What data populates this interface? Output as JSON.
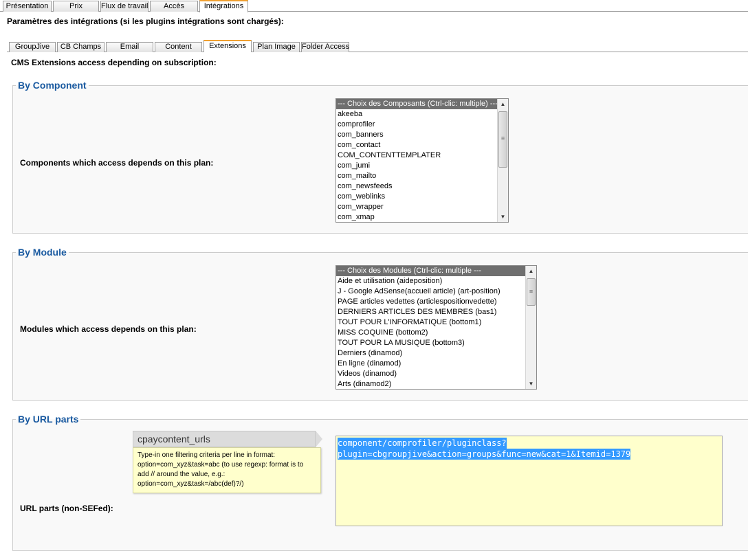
{
  "top_tabs": [
    {
      "label": "Présentation"
    },
    {
      "label": "Prix"
    },
    {
      "label": "Flux de travail"
    },
    {
      "label": "Accès"
    },
    {
      "label": "Intégrations",
      "active": true
    }
  ],
  "page_title": "Paramètres des intégrations (si les plugins intégrations sont chargés):",
  "sub_tabs": [
    {
      "label": "GroupJive"
    },
    {
      "label": "CB Champs"
    },
    {
      "label": "Email"
    },
    {
      "label": "Content"
    },
    {
      "label": "Extensions",
      "active": true
    },
    {
      "label": "Plan Image"
    },
    {
      "label": "Folder Access"
    }
  ],
  "sub_title": "CMS Extensions access depending on subscription:",
  "component_section": {
    "legend": "By Component",
    "label": "Components which access depends on this plan:",
    "options": [
      "--- Choix des Composants (Ctrl-clic: multiple) ---",
      "akeeba",
      "comprofiler",
      "com_banners",
      "com_contact",
      "COM_CONTENTTEMPLATER",
      "com_jumi",
      "com_mailto",
      "com_newsfeeds",
      "com_weblinks",
      "com_wrapper",
      "com_xmap"
    ]
  },
  "module_section": {
    "legend": "By Module",
    "label": "Modules which access depends on this plan:",
    "options": [
      "--- Choix des Modules (Ctrl-clic: multiple ---",
      "Aide et utilisation (aideposition)",
      "J - Google AdSense(accueil article) (art-position)",
      "PAGE articles vedettes (articlespositionvedette)",
      "DERNIERS ARTICLES DES MEMBRES (bas1)",
      "TOUT POUR L'INFORMATIQUE (bottom1)",
      "MISS COQUINE (bottom2)",
      "TOUT POUR LA MUSIQUE (bottom3)",
      "Derniers (dinamod)",
      "En ligne (dinamod)",
      "Videos (dinamod)",
      "Arts (dinamod2)"
    ]
  },
  "url_section": {
    "legend": "By URL parts",
    "label": "URL parts (non-SEFed):",
    "tooltip_title": "cpaycontent_urls",
    "tooltip_lines": [
      "Type-in one filtering criteria per line in format:",
      "option=com_xyz&task=abc (to use regexp: format is to",
      "add // around the value, e.g.:",
      "option=com_xyz&task=/abc(def)?/)"
    ],
    "value_lines": [
      "component/comprofiler/pluginclass?",
      "plugin=cbgroupjive&action=groups&func=new&cat=1&Itemid=1379"
    ]
  },
  "colors": {
    "legend": "#1a5aa0",
    "active_tab_top": "#f0a030",
    "selection": "#3399ff",
    "tooltip_bg": "#ffffcc"
  }
}
